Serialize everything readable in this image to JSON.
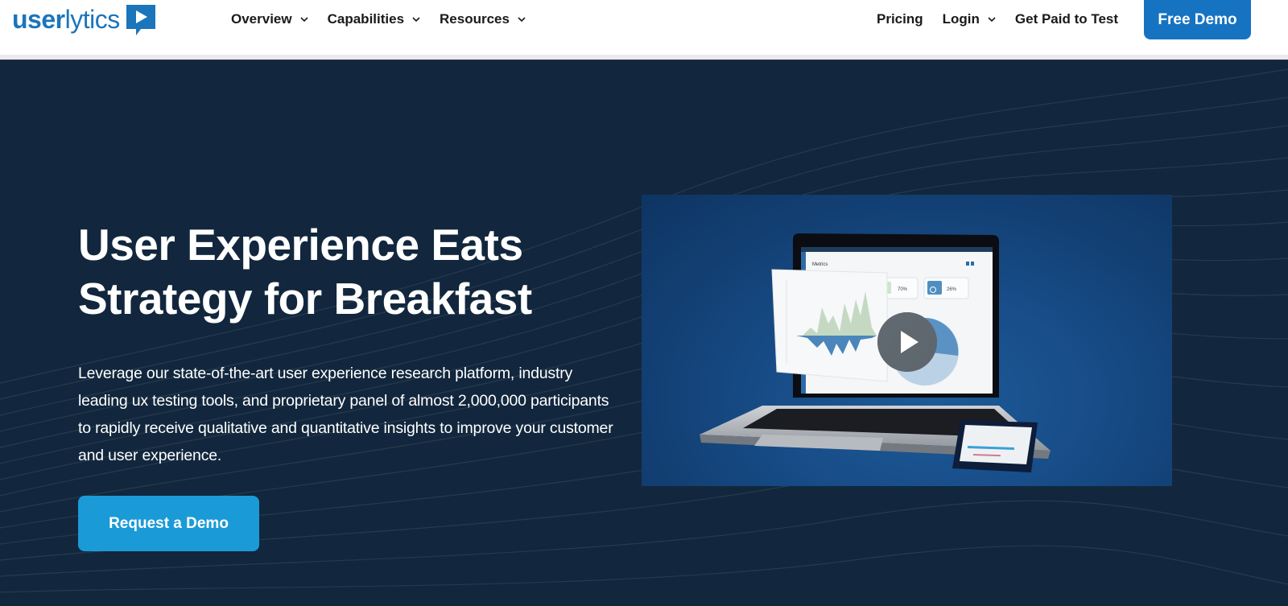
{
  "header": {
    "logo": {
      "bold": "user",
      "light": "lytics",
      "icon": "play-bubble-icon"
    },
    "nav_left": [
      {
        "label": "Overview",
        "icon": "chevron-down-icon"
      },
      {
        "label": "Capabilities",
        "icon": "chevron-down-icon"
      },
      {
        "label": "Resources",
        "icon": "chevron-down-icon"
      }
    ],
    "nav_right": [
      {
        "label": "Pricing"
      },
      {
        "label": "Login",
        "icon": "chevron-down-icon"
      },
      {
        "label": "Get Paid to Test"
      }
    ],
    "cta_label": "Free Demo"
  },
  "hero": {
    "title_line1": "User Experience Eats",
    "title_line2": "Strategy for Breakfast",
    "description": "Leverage our state-of-the-art user experience research platform, industry leading ux testing tools, and proprietary panel of almost 2,000,000 participants to rapidly receive qualitative and quantitative insights to improve your customer and user experience.",
    "cta_label": "Request a Demo"
  },
  "video": {
    "icon": "play-icon",
    "screen_title": "Metrics",
    "stat_search": "70%",
    "stat_gender": "26%",
    "stat_search_icon": "search-icon",
    "stat_gender_icon": "male-icon"
  },
  "colors": {
    "brand": "#1b75bb",
    "free_demo_bg": "#1673c2",
    "hero_bg": "#12273d",
    "cta_bg": "#1b9ad8",
    "video_bg": "#184e8a"
  }
}
